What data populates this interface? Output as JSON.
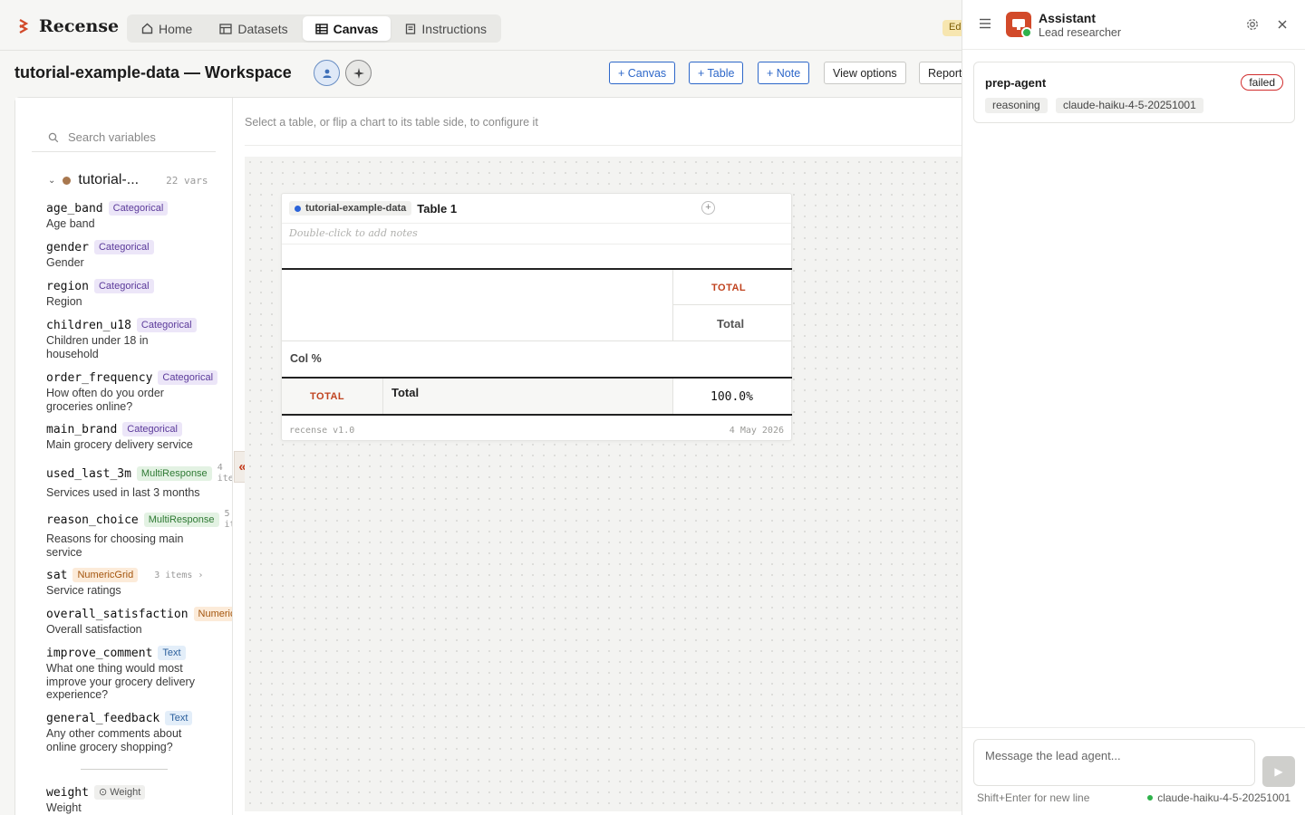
{
  "app": {
    "name": "Recense"
  },
  "nav": {
    "tabs": [
      {
        "label": "Home",
        "icon": "home-icon"
      },
      {
        "label": "Datasets",
        "icon": "table-icon"
      },
      {
        "label": "Canvas",
        "icon": "grid-icon",
        "active": true
      },
      {
        "label": "Instructions",
        "icon": "document-icon"
      }
    ],
    "edit_chip": "Ed"
  },
  "workspace": {
    "title": "tutorial-example-data — Workspace",
    "buttons": {
      "canvas": "+ Canvas",
      "table": "+ Table",
      "note": "+ Note",
      "view_options": "View options",
      "report": "Report"
    }
  },
  "sidebar": {
    "search_placeholder": "Search variables",
    "group": {
      "name": "tutorial-...",
      "count": "22 vars"
    },
    "variables": [
      {
        "name": "age_band",
        "type": "Categorical",
        "desc": "Age band"
      },
      {
        "name": "gender",
        "type": "Categorical",
        "desc": "Gender"
      },
      {
        "name": "region",
        "type": "Categorical",
        "desc": "Region"
      },
      {
        "name": "children_u18",
        "type": "Categorical",
        "desc": "Children under 18 in household"
      },
      {
        "name": "order_frequency",
        "type": "Categorical",
        "desc": "How often do you order groceries online?"
      },
      {
        "name": "main_brand",
        "type": "Categorical",
        "desc": "Main grocery delivery service"
      },
      {
        "name": "used_last_3m",
        "type": "MultiResponse",
        "items": "4 ite",
        "desc": "Services used in last 3 months"
      },
      {
        "name": "reason_choice",
        "type": "MultiResponse",
        "items": "5 it",
        "desc": "Reasons for choosing main service"
      },
      {
        "name": "sat",
        "type": "NumericGrid",
        "items": "3 items ›",
        "desc": "Service ratings"
      },
      {
        "name": "overall_satisfaction",
        "type": "Numeric",
        "desc": "Overall satisfaction"
      },
      {
        "name": "improve_comment",
        "type": "Text",
        "desc": "What one thing would most improve your grocery delivery experience?"
      },
      {
        "name": "general_feedback",
        "type": "Text",
        "desc": "Any other comments about online grocery shopping?"
      },
      {
        "name": "weight",
        "type": "⊙ Weight",
        "desc": "Weight"
      }
    ]
  },
  "canvas": {
    "hint": "Select a table, or flip a chart to its table side, to configure it",
    "table_card": {
      "dataset": "tutorial-example-data",
      "title": "Table 1",
      "notes_placeholder": "Double-click to add notes",
      "col_header_top": "TOTAL",
      "col_header_sub": "Total",
      "stat_label": "Col %",
      "row_group": "TOTAL",
      "row_label": "Total",
      "value": "100.0%",
      "footer_left": "recense v1.0",
      "footer_right": "4 May 2026"
    },
    "collapse_glyph": "«"
  },
  "assistant": {
    "title": "Assistant",
    "subtitle": "Lead researcher",
    "agent": {
      "name": "prep-agent",
      "status": "failed",
      "tags": [
        "reasoning",
        "claude-haiku-4-5-20251001"
      ]
    },
    "composer_placeholder": "Message the lead agent...",
    "hint": "Shift+Enter for new line",
    "model": "claude-haiku-4-5-20251001",
    "send_glyph": "▶"
  },
  "colors": {
    "accent_red": "#c0431f",
    "link_blue": "#2d67c9",
    "failed_border": "#d12d2d",
    "online_green": "#2fb24b"
  }
}
